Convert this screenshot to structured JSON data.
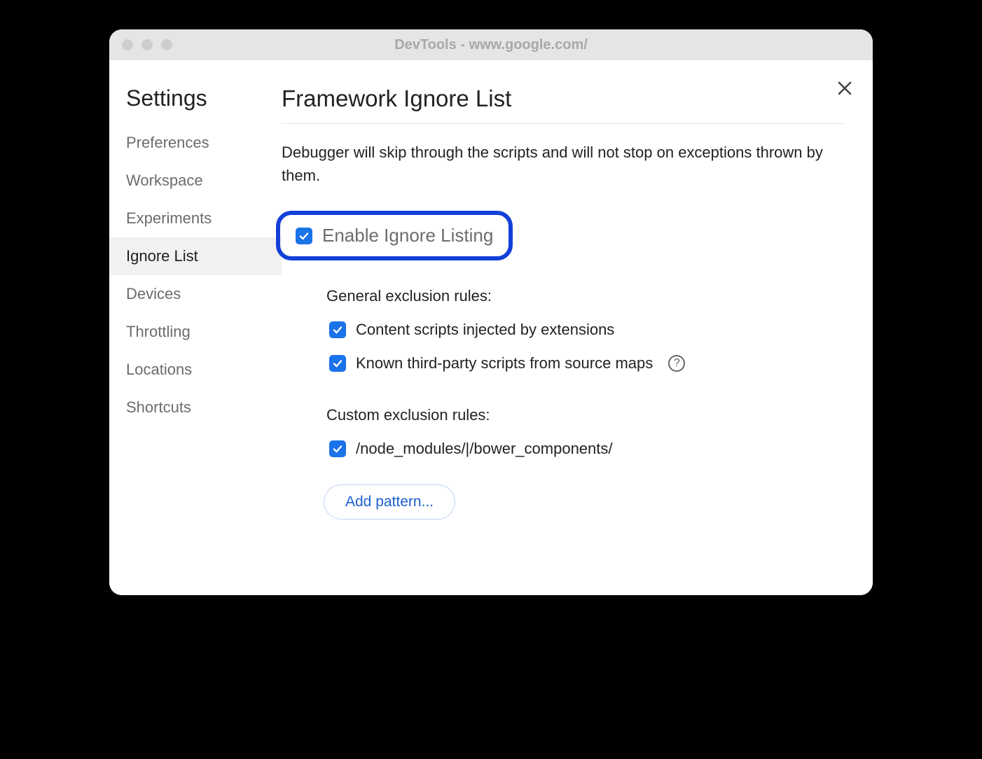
{
  "window_title": "DevTools - www.google.com/",
  "close_icon": "×",
  "sidebar": {
    "title": "Settings",
    "items": [
      {
        "label": "Preferences",
        "selected": false
      },
      {
        "label": "Workspace",
        "selected": false
      },
      {
        "label": "Experiments",
        "selected": false
      },
      {
        "label": "Ignore List",
        "selected": true
      },
      {
        "label": "Devices",
        "selected": false
      },
      {
        "label": "Throttling",
        "selected": false
      },
      {
        "label": "Locations",
        "selected": false
      },
      {
        "label": "Shortcuts",
        "selected": false
      }
    ]
  },
  "main": {
    "title": "Framework Ignore List",
    "description": "Debugger will skip through the scripts and will not stop on exceptions thrown by them.",
    "enable_label": "Enable Ignore Listing",
    "enable_checked": true,
    "general_heading": "General exclusion rules:",
    "general_rules": [
      {
        "label": "Content scripts injected by extensions",
        "checked": true,
        "help": false
      },
      {
        "label": "Known third-party scripts from source maps",
        "checked": true,
        "help": true
      }
    ],
    "custom_heading": "Custom exclusion rules:",
    "custom_rules": [
      {
        "label": "/node_modules/|/bower_components/",
        "checked": true
      }
    ],
    "add_pattern_label": "Add pattern..."
  }
}
